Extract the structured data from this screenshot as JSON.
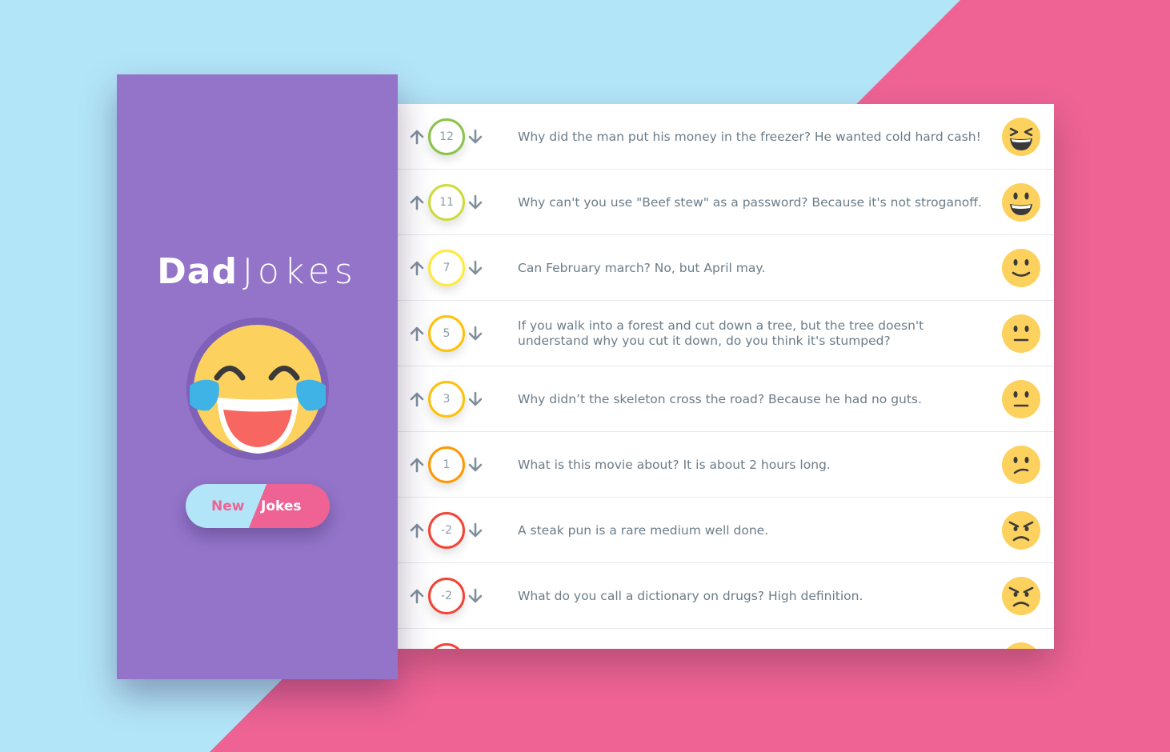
{
  "app": {
    "title_bold": "Dad",
    "title_light": "Jokes",
    "big_emoji_icon": "laughing-tears-icon",
    "new_button_word1": "New",
    "new_button_word2": "Jokes"
  },
  "colors": {
    "background_blue": "#b3e5f8",
    "background_pink": "#ee6394",
    "sidebar_purple": "#9374c9",
    "emoji_yellow": "#fdd15d",
    "arrow_gray": "#7f8f9c",
    "text_gray": "#6b7c88"
  },
  "jokes": [
    {
      "votes": "12",
      "score_color": "#8bc34a",
      "text": "Why did the man put his money in the freezer? He wanted cold hard cash!",
      "emoji": "laughing"
    },
    {
      "votes": "11",
      "score_color": "#cddc39",
      "text": "Why can't you use \"Beef stew\" as a password? Because it's not stroganoff.",
      "emoji": "grin"
    },
    {
      "votes": "7",
      "score_color": "#ffeb3b",
      "text": "Can February march? No, but April may.",
      "emoji": "smile"
    },
    {
      "votes": "5",
      "score_color": "#ffc107",
      "text": "If you walk into a forest and cut down a tree, but the tree doesn't understand why you cut it down, do you think it's stumped?",
      "emoji": "neutral"
    },
    {
      "votes": "3",
      "score_color": "#ffc107",
      "text": "Why didn’t the skeleton cross the road? Because he had no guts.",
      "emoji": "neutral"
    },
    {
      "votes": "1",
      "score_color": "#ff9800",
      "text": "What is this movie about? It is about 2 hours long.",
      "emoji": "confused"
    },
    {
      "votes": "-2",
      "score_color": "#f44336",
      "text": "A steak pun is a rare medium well done.",
      "emoji": "angry"
    },
    {
      "votes": "-2",
      "score_color": "#f44336",
      "text": "What do you call a dictionary on drugs? High definition.",
      "emoji": "angry"
    }
  ]
}
